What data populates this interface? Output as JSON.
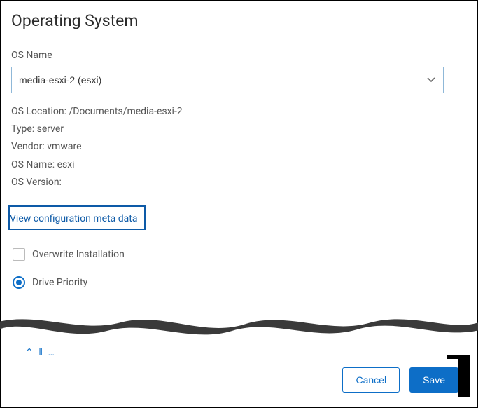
{
  "header": {
    "title": "Operating System"
  },
  "form": {
    "os_name_label": "OS Name",
    "os_name_value": "media-esxi-2 (esxi)"
  },
  "details": {
    "os_location": "OS Location: /Documents/media-esxi-2",
    "type": "Type: server",
    "vendor": "Vendor: vmware",
    "os_name": "OS Name: esxi",
    "os_version": "OS Version:"
  },
  "links": {
    "view_meta": "View configuration meta data"
  },
  "options": {
    "overwrite_label": "Overwrite Installation",
    "drive_priority_label": "Drive Priority"
  },
  "cutoff": "⌃ ‖ …",
  "footer": {
    "cancel": "Cancel",
    "save": "Save"
  }
}
